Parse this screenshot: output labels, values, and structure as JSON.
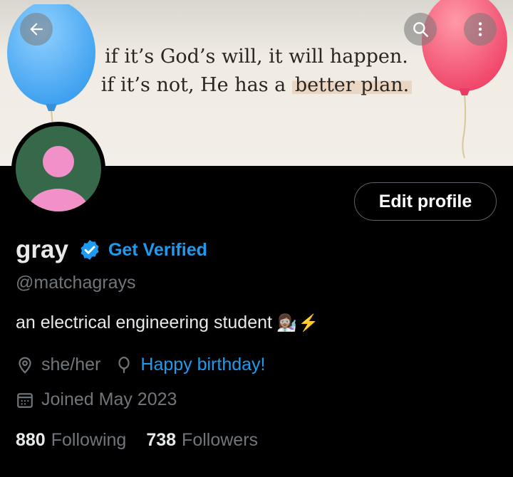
{
  "banner": {
    "quote_line1": "if it’s God’s will, it will happen.",
    "quote_line2_start": "if it’s not, He has a ",
    "quote_line2_highlight": "better plan.",
    "back_icon": "arrow-left-icon",
    "search_icon": "search-icon",
    "more_icon": "more-vertical-icon"
  },
  "profile": {
    "edit_button_label": "Edit profile",
    "name": "gray",
    "get_verified_label": "Get Verified",
    "handle": "@matchagrays",
    "bio_text": "an electrical engineering student",
    "bio_emoji_scientist": "👩🏽‍🔬",
    "bio_emoji_bolt": "⚡",
    "pronouns": "she/her",
    "birthday_link": "Happy birthday!",
    "joined": "Joined May 2023",
    "following_count": "880",
    "following_label": "Following",
    "followers_count": "738",
    "followers_label": "Followers"
  },
  "colors": {
    "accent": "#1d9bf0",
    "muted": "#71767b",
    "text": "#e7e9ea",
    "avatar_bg": "#36694a",
    "avatar_figure": "#f190c9"
  }
}
